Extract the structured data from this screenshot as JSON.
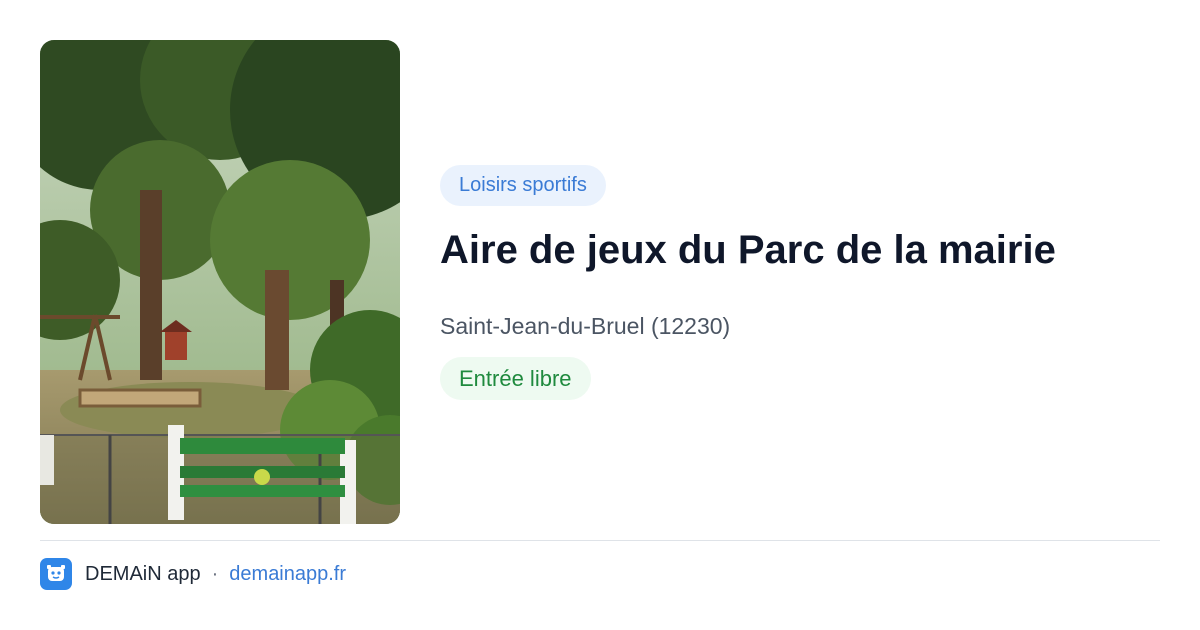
{
  "card": {
    "category": "Loisirs sportifs",
    "title": "Aire de jeux du Parc de la mairie",
    "location": "Saint-Jean-du-Bruel (12230)",
    "access": "Entrée libre"
  },
  "footer": {
    "app_name": "DEMAiN app",
    "separator": "·",
    "site": "demainapp.fr"
  },
  "icons": {
    "photo": "park-playground-photo",
    "logo": "demain-app-logo-icon"
  },
  "colors": {
    "category_bg": "#eaf2fd",
    "category_text": "#3a7bd5",
    "access_bg": "#eefaf1",
    "access_text": "#1f8a3e",
    "link": "#3a7bd5",
    "logo_bg": "#2f86e8"
  }
}
